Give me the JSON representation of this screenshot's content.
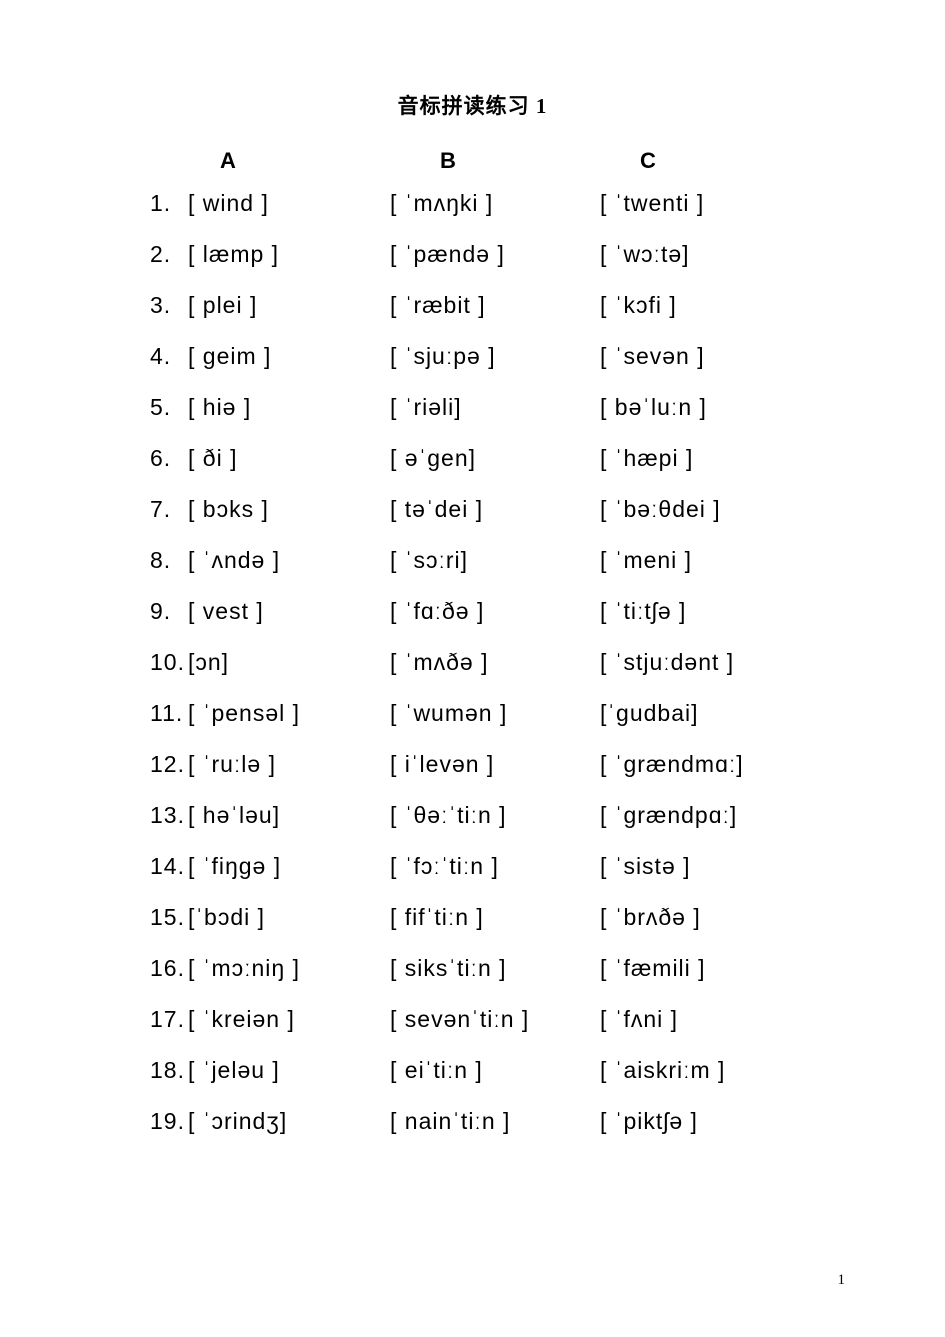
{
  "title": "音标拼读练习 1",
  "headers": {
    "a": "A",
    "b": "B",
    "c": "C"
  },
  "rows": [
    {
      "n": "1.",
      "a": "[ wind ]",
      "b": "[ ˈmʌŋki ]",
      "c": "[ ˈtwenti ]"
    },
    {
      "n": "2.",
      "a": "[ læmp ]",
      "b": "[ ˈpændə ]",
      "c": "[ ˈwɔːtə]"
    },
    {
      "n": "3.",
      "a": "[ plei ]",
      "b": "[ ˈræbit ]",
      "c": "[ ˈkɔfi ]"
    },
    {
      "n": "4.",
      "a": "[ geim ]",
      "b": "[ ˈsjuːpə ]",
      "c": "[ ˈsevən ]"
    },
    {
      "n": "5.",
      "a": "[ hiə ]",
      "b": "[ ˈriəli]",
      "c": "[ bəˈluːn ]"
    },
    {
      "n": "6.",
      "a": "[ ði ]",
      "b": "[ əˈgen]",
      "c": "[ ˈhæpi ]"
    },
    {
      "n": "7.",
      "a": "[ bɔks ]",
      "b": "[ təˈdei ]",
      "c": "[ ˈbəːθdei ]"
    },
    {
      "n": "8.",
      "a": "[ ˈʌndə ]",
      "b": "[ ˈsɔːri]",
      "c": "[ ˈmeni ]"
    },
    {
      "n": "9.",
      "a": "[ vest ]",
      "b": "[ ˈfɑːðə ]",
      "c": "[ ˈtiːtʃə ]"
    },
    {
      "n": "10.",
      "a": "[ɔn]",
      "b": "[ ˈmʌðə ]",
      "c": "[ ˈstjuːdənt ]"
    },
    {
      "n": "11.",
      "a": "[ ˈpensəl ]",
      "b": "[ ˈwumən ]",
      "c": "[ˈgudbai]"
    },
    {
      "n": "12.",
      "a": "[ ˈruːlə ]",
      "b": "[ iˈlevən ]",
      "c": "[ ˈgrændmɑː]"
    },
    {
      "n": "13.",
      "a": "[ həˈləu]",
      "b": "[ ˈθəːˈtiːn ]",
      "c": "[ ˈgrændpɑː]"
    },
    {
      "n": "14.",
      "a": "[ ˈfiŋgə ]",
      "b": "[ ˈfɔːˈtiːn ]",
      "c": "[ ˈsistə ]"
    },
    {
      "n": "15.",
      "a": "[ˈbɔdi ]",
      "b": "[ fifˈtiːn ]",
      "c": "[ ˈbrʌðə ]"
    },
    {
      "n": "16.",
      "a": "[ ˈmɔːniŋ ]",
      "b": "[ siksˈtiːn ]",
      "c": "[ ˈfæmili ]"
    },
    {
      "n": "17.",
      "a": "[ ˈkreiən ]",
      "b": "[ sevənˈtiːn ]",
      "c": "[ ˈfʌni ]"
    },
    {
      "n": "18.",
      "a": "[ ˈjeləu ]",
      "b": "[ eiˈtiːn ]",
      "c": "[ ˈaiskriːm ]"
    },
    {
      "n": "19.",
      "a": "[ ˈɔrindʒ]",
      "b": "[ nainˈtiːn ]",
      "c": "[ ˈpiktʃə ]"
    }
  ],
  "page_number": "1"
}
